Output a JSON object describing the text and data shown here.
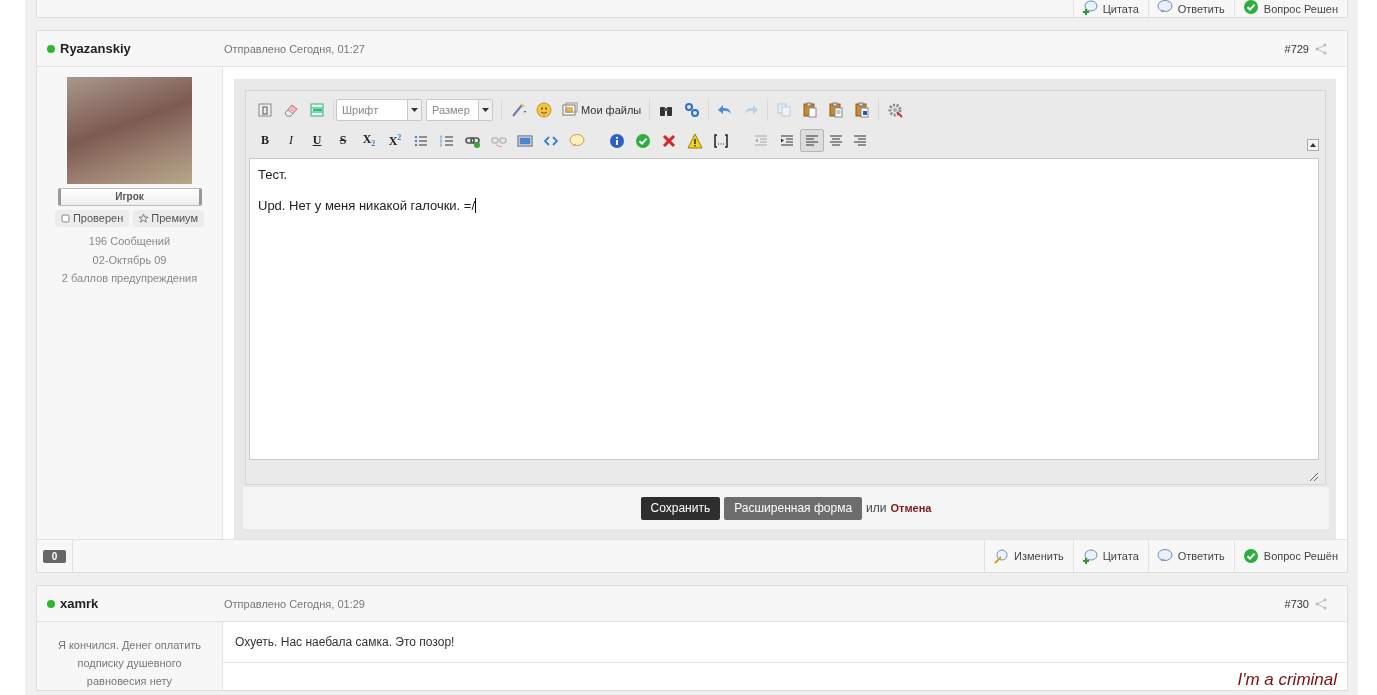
{
  "previous_post_actions": [
    {
      "kind": "quote",
      "label": "Цитата"
    },
    {
      "kind": "reply",
      "label": "Ответить"
    },
    {
      "kind": "solved",
      "label": "Вопрос Решен"
    }
  ],
  "editing_post": {
    "author": "Ryazanskiy",
    "online": true,
    "posted": "Отправлено Сегодня, 01:27",
    "number": "#729",
    "rank": "Игрок",
    "badges": [
      {
        "kind": "verified",
        "label": "Проверен"
      },
      {
        "kind": "premium",
        "label": "Премиум"
      }
    ],
    "stats": [
      "196 Сообщений",
      "02-Октябрь 09",
      "2 баллов предупреждения"
    ],
    "editor": {
      "font_placeholder": "Шрифт",
      "size_placeholder": "Размер",
      "files_label": "Мои файлы",
      "format_buttons": [
        {
          "kind": "bold",
          "label": "B"
        },
        {
          "kind": "italic",
          "label": "I"
        },
        {
          "kind": "underline",
          "label": "U"
        },
        {
          "kind": "strike",
          "label": "S"
        },
        {
          "kind": "subscript",
          "label": "X$_{2}$"
        },
        {
          "kind": "superscript",
          "label": "X$^{2}$"
        }
      ],
      "align_buttons": [
        {
          "kind": "left",
          "selected": true
        },
        {
          "kind": "center",
          "selected": false
        },
        {
          "kind": "right",
          "selected": false
        }
      ],
      "paragraphs": [
        "Тест.",
        "Upd. Нет у меня никакой галочки. =/"
      ],
      "save_label": "Сохранить",
      "full_form_label": "Расширенная форма",
      "or_text": "или",
      "cancel_label": "Отмена"
    },
    "reputation": "0",
    "actions": [
      {
        "kind": "edit",
        "label": "Изменить"
      },
      {
        "kind": "quote",
        "label": "Цитата"
      },
      {
        "kind": "reply",
        "label": "Ответить"
      },
      {
        "kind": "solved",
        "label": "Вопрос Решён"
      }
    ]
  },
  "next_post": {
    "author": "xamrk",
    "online": true,
    "posted": "Отправлено Сегодня, 01:29",
    "number": "#730",
    "status_text": "Я кончился. Денег оплатить подписку душевного равновесия нету",
    "message": "Охуеть. Нас наебала самка. Это позор!",
    "signature": "I'm a criminal"
  }
}
